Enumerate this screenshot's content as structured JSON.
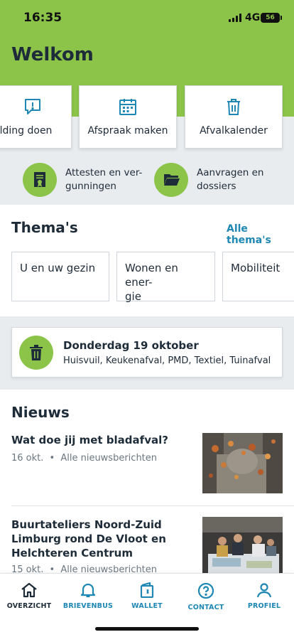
{
  "status_bar": {
    "time": "16:35",
    "network": "4G",
    "battery": "56"
  },
  "header": {
    "title": "Welkom"
  },
  "quick_actions": [
    {
      "label": "elding doen",
      "icon": "report-icon"
    },
    {
      "label": "Afspraak maken",
      "icon": "calendar-icon"
    },
    {
      "label": "Afvalkalender",
      "icon": "trash-icon"
    }
  ],
  "quick_links": [
    {
      "line1": "Attesten en ver-",
      "line2": "gunningen",
      "icon": "certificate-icon"
    },
    {
      "line1": "Aanvragen en",
      "line2": "dossiers",
      "icon": "folder-icon"
    }
  ],
  "themes": {
    "title": "Thema's",
    "all_link": "Alle thema's",
    "items": [
      {
        "line1": "U en uw gezin",
        "line2": ""
      },
      {
        "line1": "Wonen en ener-",
        "line2": "gie"
      },
      {
        "line1": "Mobiliteit",
        "line2": ""
      }
    ]
  },
  "waste": {
    "date": "Donderdag 19 oktober",
    "types": "Huisvuil, Keukenafval, PMD, Textiel, Tuinafval",
    "icon": "trash-icon"
  },
  "news": {
    "title": "Nieuws",
    "items": [
      {
        "title": "Wat doe jij met bladafval?",
        "date": "16 okt.",
        "separator": "•",
        "category": "Alle nieuwsberichten"
      },
      {
        "title": "Buurtateliers Noord-Zuid Limburg rond De Vloot en Helchteren Centrum",
        "date": "15 okt.",
        "separator": "•",
        "category": "Alle nieuwsberichten"
      }
    ]
  },
  "tabbar": {
    "items": [
      {
        "label": "OVERZICHT",
        "icon": "home-icon",
        "active": true
      },
      {
        "label": "BRIEVENBUS",
        "icon": "bell-icon",
        "active": false
      },
      {
        "label": "WALLET",
        "icon": "wallet-icon",
        "active": false
      },
      {
        "label": "CONTACT",
        "icon": "help-icon",
        "active": false
      },
      {
        "label": "PROFIEL",
        "icon": "user-icon",
        "active": false
      }
    ]
  },
  "colors": {
    "brand_green": "#8cc44a",
    "link_blue": "#1e87b3",
    "dark_text": "#1e2b38",
    "active_tab": "#1e2b38"
  }
}
